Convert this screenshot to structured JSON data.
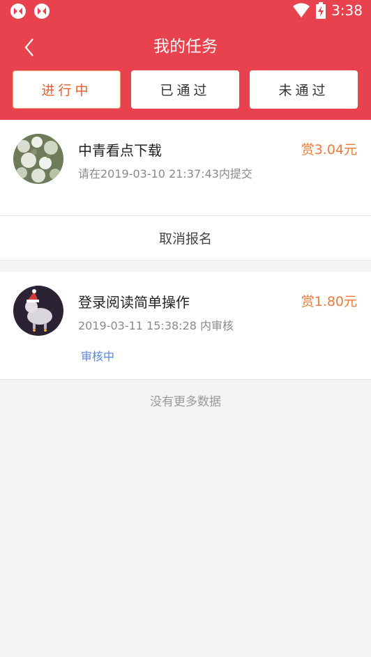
{
  "status_bar": {
    "time": "3:38",
    "icons": [
      "app-icon",
      "app-icon",
      "wifi-icon",
      "battery-charging-icon"
    ]
  },
  "nav": {
    "title": "我的任务",
    "back_icon": "chevron-left-icon"
  },
  "tabs": [
    {
      "label": "进行中",
      "active": true
    },
    {
      "label": "已通过",
      "active": false
    },
    {
      "label": "未通过",
      "active": false
    }
  ],
  "tasks": [
    {
      "title": "中青看点下载",
      "reward": "赏3.04元",
      "subtitle": "请在2019-03-10 21:37:43内提交",
      "action": "取消报名"
    },
    {
      "title": "登录阅读简单操作",
      "reward": "赏1.80元",
      "subtitle": "2019-03-11 15:38:28 内审核",
      "status": "审核中"
    }
  ],
  "footer": "没有更多数据",
  "colors": {
    "header": "#e8424f",
    "reward": "#f07a3a",
    "active_tab": "#e85c2a",
    "status_badge": "#5a84e0"
  }
}
